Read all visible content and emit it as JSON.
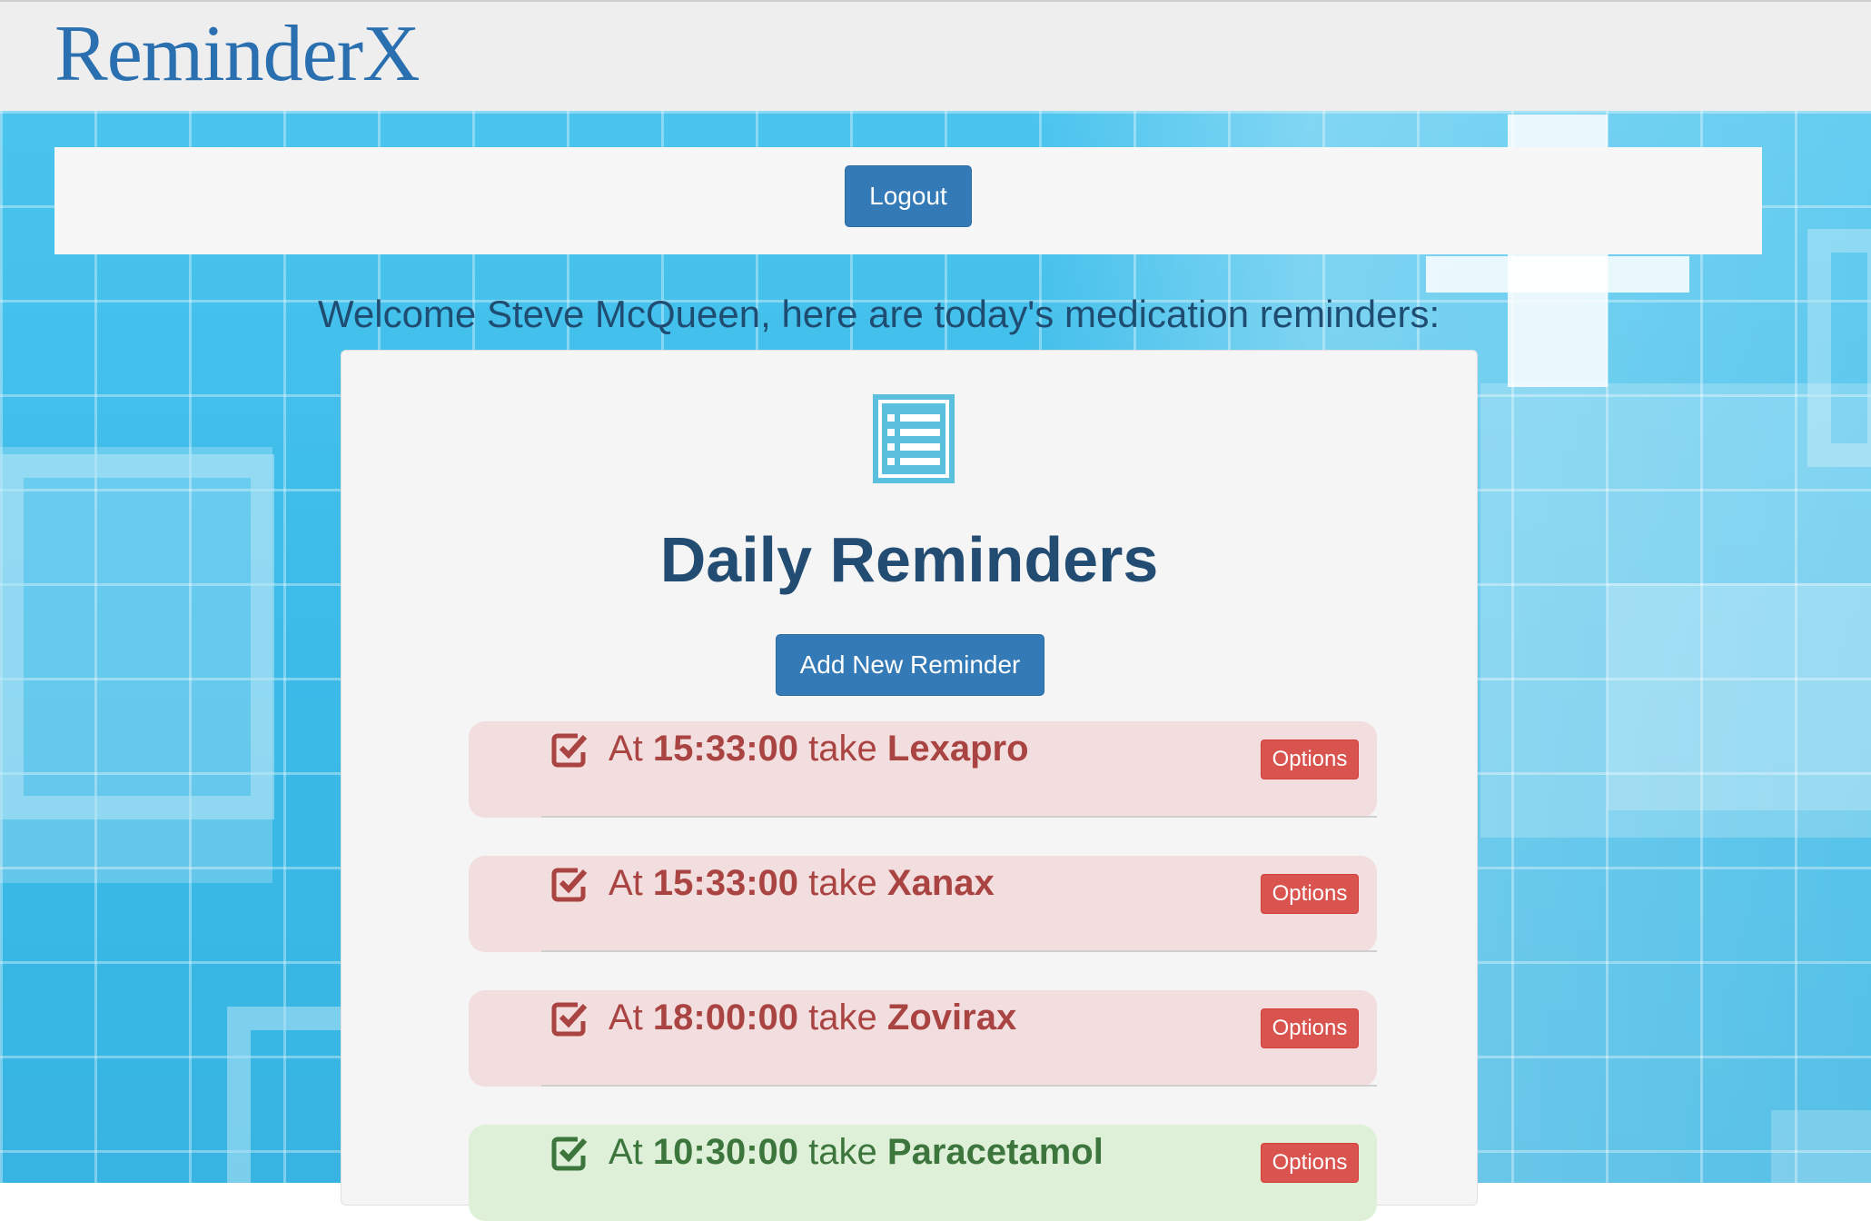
{
  "app": {
    "brand": "ReminderX"
  },
  "header": {
    "logout_label": "Logout"
  },
  "main": {
    "welcome": "Welcome Steve McQueen, here are today's medication reminders:",
    "panel_title": "Daily Reminders",
    "add_label": "Add New Reminder",
    "reminders": [
      {
        "prefix": "At",
        "time": "15:33:00",
        "verb": "take",
        "medication": "Lexapro",
        "status": "pending",
        "options_label": "Options"
      },
      {
        "prefix": "At",
        "time": "15:33:00",
        "verb": "take",
        "medication": "Xanax",
        "status": "pending",
        "options_label": "Options"
      },
      {
        "prefix": "At",
        "time": "18:00:00",
        "verb": "take",
        "medication": "Zovirax",
        "status": "pending",
        "options_label": "Options"
      },
      {
        "prefix": "At",
        "time": "10:30:00",
        "verb": "take",
        "medication": "Paracetamol",
        "status": "taken",
        "options_label": "Options"
      }
    ]
  },
  "colors": {
    "brand": "#2a6fb0",
    "primary_button": "#337ab7",
    "danger_button": "#d9534f",
    "pending_bg": "#f2dede",
    "pending_text": "#a94442",
    "taken_bg": "#dff0d8",
    "taken_text": "#3c763d",
    "page_bg": "#3bbbe8"
  },
  "icons": [
    "list-icon",
    "check-square-icon"
  ]
}
